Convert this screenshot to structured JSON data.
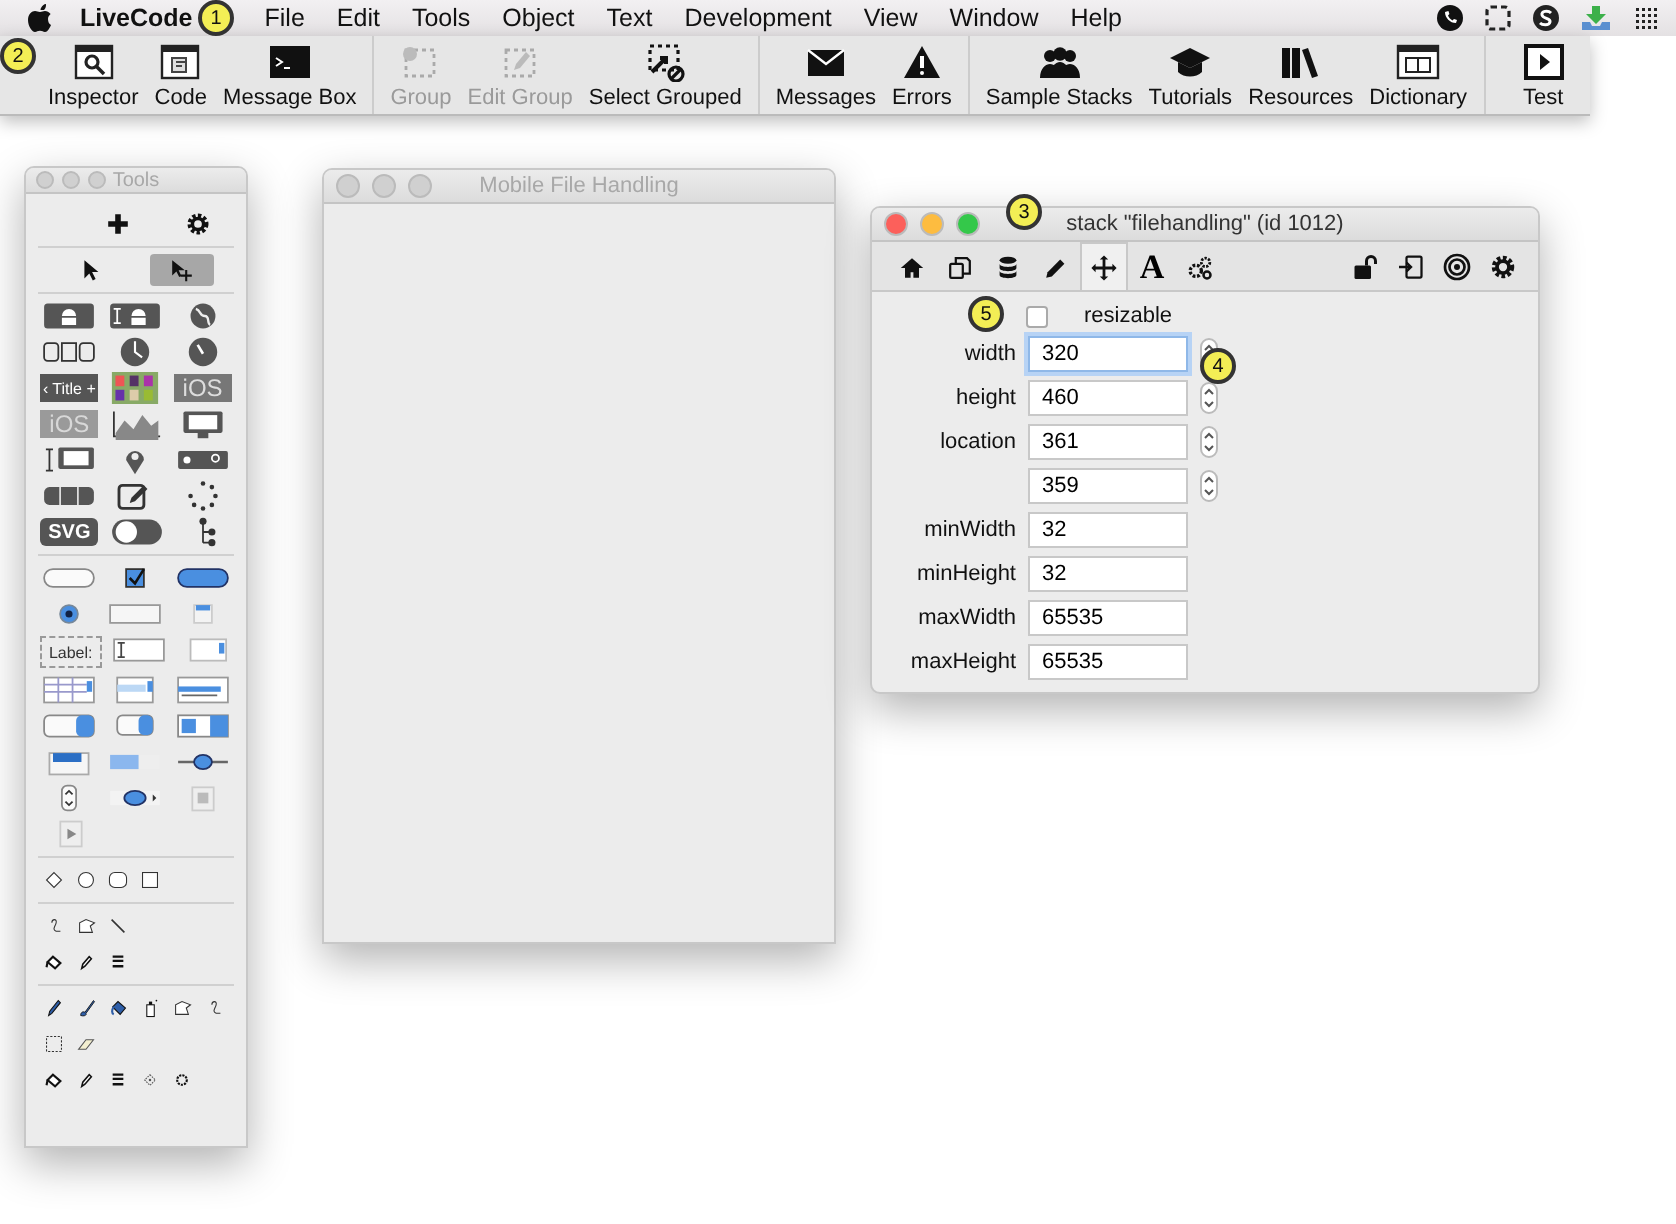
{
  "menu_bar": {
    "app": "LiveCode",
    "items": [
      "File",
      "Edit",
      "Tools",
      "Object",
      "Text",
      "Development",
      "View",
      "Window",
      "Help"
    ]
  },
  "toolbar": {
    "groups": [
      [
        {
          "kind": "inspector",
          "label": "Inspector",
          "disabled": false
        },
        {
          "kind": "code",
          "label": "Code",
          "disabled": false
        },
        {
          "kind": "message-box",
          "label": "Message Box",
          "disabled": false
        }
      ],
      [
        {
          "kind": "group",
          "label": "Group",
          "disabled": true
        },
        {
          "kind": "edit-group",
          "label": "Edit Group",
          "disabled": true
        },
        {
          "kind": "select-grouped",
          "label": "Select Grouped",
          "disabled": false
        }
      ],
      [
        {
          "kind": "messages",
          "label": "Messages",
          "disabled": false
        },
        {
          "kind": "errors",
          "label": "Errors",
          "disabled": false
        }
      ],
      [
        {
          "kind": "sample-stacks",
          "label": "Sample Stacks",
          "disabled": false
        },
        {
          "kind": "tutorials",
          "label": "Tutorials",
          "disabled": false
        },
        {
          "kind": "resources",
          "label": "Resources",
          "disabled": false
        },
        {
          "kind": "dictionary",
          "label": "Dictionary",
          "disabled": false
        }
      ],
      [
        {
          "kind": "test",
          "label": "Test",
          "disabled": false
        }
      ]
    ]
  },
  "tools_window": {
    "title": "Tools",
    "active": false,
    "sections": [
      [
        [
          {
            "kind": "plus",
            "selected": false
          },
          {
            "kind": "gear",
            "selected": false
          }
        ]
      ],
      [
        [
          {
            "kind": "pointer",
            "selected": false
          },
          {
            "kind": "edit-pointer",
            "selected": true
          }
        ]
      ],
      [
        [
          {
            "kind": "android-button"
          },
          {
            "kind": "android-field"
          },
          {
            "kind": "globe"
          }
        ],
        [
          {
            "kind": "segmented"
          },
          {
            "kind": "clock"
          },
          {
            "kind": "gauge"
          }
        ],
        [
          {
            "kind": "title-bar",
            "text": "‹ Title +"
          },
          {
            "kind": "swatches"
          },
          {
            "kind": "ios-dark",
            "text": "iOS"
          }
        ],
        [
          {
            "kind": "ios-light",
            "text": "iOS"
          },
          {
            "kind": "line-graph"
          },
          {
            "kind": "desktop"
          }
        ],
        [
          {
            "kind": "field-desktop"
          },
          {
            "kind": "map-pin"
          },
          {
            "kind": "search-bar"
          }
        ],
        [
          {
            "kind": "segmented-dark"
          },
          {
            "kind": "edit"
          },
          {
            "kind": "spinner"
          }
        ],
        [
          {
            "kind": "svg-label",
            "text": "SVG"
          },
          {
            "kind": "toggle"
          },
          {
            "kind": "tree"
          }
        ]
      ],
      [
        [
          {
            "kind": "push-button"
          },
          {
            "kind": "checkbox"
          },
          {
            "kind": "default-button"
          }
        ],
        [
          {
            "kind": "radio"
          },
          {
            "kind": "rectangle-button"
          },
          {
            "kind": "small-button"
          }
        ],
        [
          {
            "kind": "label-field",
            "text": "Label:"
          },
          {
            "kind": "text-field"
          },
          {
            "kind": "scrolling-field"
          }
        ],
        [
          {
            "kind": "table-field"
          },
          {
            "kind": "list-field"
          },
          {
            "kind": "scrolling-list"
          }
        ],
        [
          {
            "kind": "option-menu"
          },
          {
            "kind": "pulldown"
          },
          {
            "kind": "combo-box"
          }
        ],
        [
          {
            "kind": "tab-panel"
          },
          {
            "kind": "progress-bar"
          },
          {
            "kind": "slider"
          }
        ],
        [
          {
            "kind": "little-arrows"
          },
          {
            "kind": "scrollbar"
          },
          {
            "kind": "image"
          }
        ],
        [
          {
            "kind": "player"
          }
        ]
      ],
      [
        [
          {
            "kind": "diamond"
          },
          {
            "kind": "circle"
          },
          {
            "kind": "rounded-rect"
          },
          {
            "kind": "square"
          }
        ]
      ],
      [
        [
          {
            "kind": "curve"
          },
          {
            "kind": "polygon"
          },
          {
            "kind": "line"
          }
        ],
        [
          {
            "kind": "bucket"
          },
          {
            "kind": "pen"
          },
          {
            "kind": "line-widths"
          }
        ]
      ],
      [
        [
          {
            "kind": "pencil"
          },
          {
            "kind": "brush"
          },
          {
            "kind": "paint-bucket"
          },
          {
            "kind": "spray"
          },
          {
            "kind": "polygon"
          },
          {
            "kind": "curve"
          }
        ],
        [
          {
            "kind": "marquee"
          },
          {
            "kind": "eraser"
          }
        ],
        [
          {
            "kind": "bucket"
          },
          {
            "kind": "pen"
          },
          {
            "kind": "line-widths"
          },
          {
            "kind": "dot-diamond"
          },
          {
            "kind": "dot-gear"
          }
        ]
      ]
    ]
  },
  "stack_window": {
    "title": "Mobile File Handling",
    "active": false
  },
  "inspector": {
    "title": "stack \"filehandling\" (id 1012)",
    "active": true,
    "tabs": [
      {
        "kind": "home",
        "selected": false
      },
      {
        "kind": "copy",
        "selected": false
      },
      {
        "kind": "database",
        "selected": false
      },
      {
        "kind": "pencil",
        "selected": false
      },
      {
        "kind": "move",
        "selected": true
      },
      {
        "kind": "letter",
        "text": "A",
        "selected": false
      },
      {
        "kind": "gears",
        "selected": false
      }
    ],
    "tools": [
      {
        "kind": "lock"
      },
      {
        "kind": "export"
      },
      {
        "kind": "target"
      },
      {
        "kind": "gear"
      }
    ],
    "resizable": {
      "label": "resizable",
      "checked": false
    },
    "fields": [
      {
        "label": "width",
        "value": "320",
        "spinner": true,
        "focused": true
      },
      {
        "label": "height",
        "value": "460",
        "spinner": true,
        "focused": false
      },
      {
        "label": "location",
        "value": "361",
        "spinner": true,
        "focused": false
      },
      {
        "value": "359",
        "spinner": true,
        "focused": false
      },
      {
        "label": "minWidth",
        "value": "32",
        "spinner": false,
        "focused": false
      },
      {
        "label": "minHeight",
        "value": "32",
        "spinner": false,
        "focused": false
      },
      {
        "label": "maxWidth",
        "value": "65535",
        "spinner": false,
        "focused": false
      },
      {
        "label": "maxHeight",
        "value": "65535",
        "spinner": false,
        "focused": false
      }
    ]
  },
  "callouts": [
    "1",
    "2",
    "3",
    "4",
    "5"
  ]
}
